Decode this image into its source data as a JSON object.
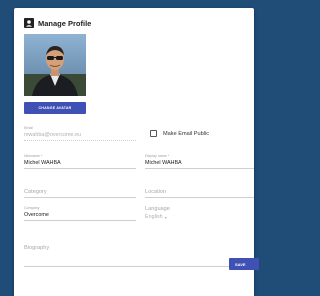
{
  "header": {
    "title": "Manage Profile",
    "icon": "account-box-icon"
  },
  "avatar": {
    "alt": "profile-photo"
  },
  "buttons": {
    "change_avatar": "CHANGE AVATAR",
    "save": "SAVE"
  },
  "email": {
    "label": "Email",
    "value": "mwahba@overcome.eu"
  },
  "make_email_public": {
    "label": "Make Email Public",
    "checked": false
  },
  "nickname": {
    "label": "Nickname *",
    "value": "Michel WAHBA"
  },
  "display_name": {
    "label": "Display name *",
    "value": "Michel WAHBA"
  },
  "category": {
    "placeholder": "Category"
  },
  "location": {
    "placeholder": "Location"
  },
  "company": {
    "label": "Company",
    "value": "Overcome"
  },
  "language": {
    "label": "Language",
    "value": "English"
  },
  "biography": {
    "placeholder": "Biography"
  },
  "colors": {
    "background": "#1f4d78",
    "primary": "#3f51b5"
  }
}
